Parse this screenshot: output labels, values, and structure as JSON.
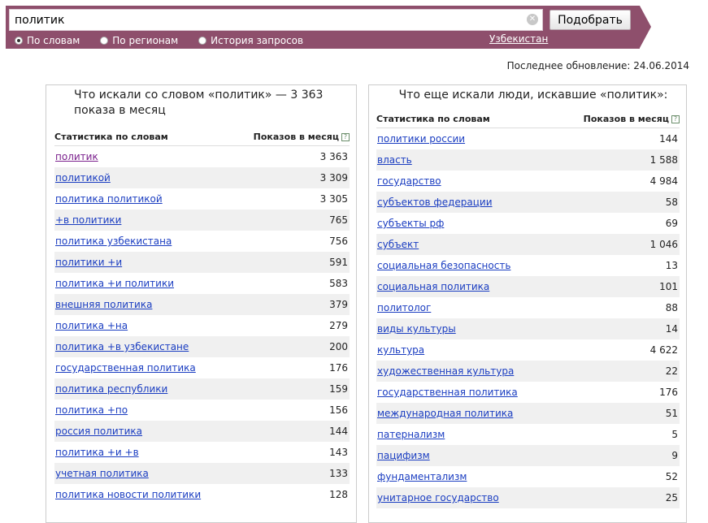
{
  "search": {
    "query": "политик",
    "submit_label": "Подобрать",
    "modes": [
      {
        "label": "По словам",
        "checked": true
      },
      {
        "label": "По регионам",
        "checked": false
      },
      {
        "label": "История запросов",
        "checked": false
      }
    ],
    "region": "Узбекистан"
  },
  "last_update": "Последнее обновление: 24.06.2014",
  "left_panel": {
    "title": "Что искали со словом «политик» — 3 363 показа в месяц",
    "col_keyword": "Статистика по словам",
    "col_count": "Показов в месяц",
    "rows": [
      {
        "keyword": "политик",
        "count": "3 363"
      },
      {
        "keyword": "политикой",
        "count": "3 309"
      },
      {
        "keyword": "политика политикой",
        "count": "3 305"
      },
      {
        "keyword": "+в политики",
        "count": "765"
      },
      {
        "keyword": "политика узбекистана",
        "count": "756"
      },
      {
        "keyword": "политики +и",
        "count": "591"
      },
      {
        "keyword": "политика +и политики",
        "count": "583"
      },
      {
        "keyword": "внешняя политика",
        "count": "379"
      },
      {
        "keyword": "политика +на",
        "count": "279"
      },
      {
        "keyword": "политика +в узбекистане",
        "count": "200"
      },
      {
        "keyword": "государственная политика",
        "count": "176"
      },
      {
        "keyword": "политика республики",
        "count": "159"
      },
      {
        "keyword": "политика +по",
        "count": "156"
      },
      {
        "keyword": "россия политика",
        "count": "144"
      },
      {
        "keyword": "политика +и +в",
        "count": "143"
      },
      {
        "keyword": "учетная политика",
        "count": "133"
      },
      {
        "keyword": "политика новости политики",
        "count": "128"
      }
    ]
  },
  "right_panel": {
    "title": "Что еще искали люди, искавшие «политик»:",
    "col_keyword": "Статистика по словам",
    "col_count": "Показов в месяц",
    "rows": [
      {
        "keyword": "политики россии",
        "count": "144"
      },
      {
        "keyword": "власть",
        "count": "1 588"
      },
      {
        "keyword": "государство",
        "count": "4 984"
      },
      {
        "keyword": "субъектов федерации",
        "count": "58"
      },
      {
        "keyword": "субъекты рф",
        "count": "69"
      },
      {
        "keyword": "субъект",
        "count": "1 046"
      },
      {
        "keyword": "социальная безопасность",
        "count": "13"
      },
      {
        "keyword": "социальная политика",
        "count": "101"
      },
      {
        "keyword": "политолог",
        "count": "88"
      },
      {
        "keyword": "виды культуры",
        "count": "14"
      },
      {
        "keyword": "культура",
        "count": "4 622"
      },
      {
        "keyword": "художественная культура",
        "count": "22"
      },
      {
        "keyword": "государственная политика",
        "count": "176"
      },
      {
        "keyword": "международная политика",
        "count": "51"
      },
      {
        "keyword": "патернализм",
        "count": "5"
      },
      {
        "keyword": "пацифизм",
        "count": "9"
      },
      {
        "keyword": "фундаментализм",
        "count": "52"
      },
      {
        "keyword": "унитарное государство",
        "count": "25"
      }
    ]
  }
}
